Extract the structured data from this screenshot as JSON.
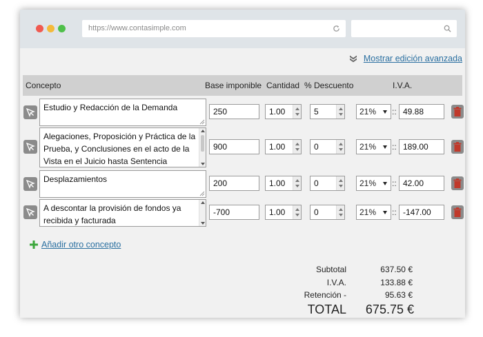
{
  "browser": {
    "url": "https://www.contasimple.com",
    "controls": [
      "close-dot",
      "minimize-dot",
      "maximize-dot"
    ],
    "colors": {
      "close": "#f05a50",
      "minimize": "#f4ba3a",
      "maximize": "#4fc04a"
    }
  },
  "toolbar": {
    "advanced_link": "Mostrar edición avanzada",
    "advanced_icon": "double-chevron-down-icon"
  },
  "table": {
    "headers": {
      "concept": "Concepto",
      "base": "Base imponible",
      "qty": "Cantidad",
      "discount": "% Descuento",
      "vat": "I.V.A."
    },
    "rows": [
      {
        "concept": "Estudio y Redacción de la Demanda",
        "base": "250",
        "qty": "1.00",
        "discount": "5",
        "vat_rate": "21%",
        "vat_sep": "::",
        "vat_amount": "49.88"
      },
      {
        "concept": "Alegaciones, Proposición y Práctica de la Prueba, y Conclusiones en el acto de la Vista en el Juicio hasta Sentencia Definitiva",
        "base": "900",
        "qty": "1.00",
        "discount": "0",
        "vat_rate": "21%",
        "vat_sep": "::",
        "vat_amount": "189.00"
      },
      {
        "concept": "Desplazamientos",
        "base": "200",
        "qty": "1.00",
        "discount": "0",
        "vat_rate": "21%",
        "vat_sep": "::",
        "vat_amount": "42.00"
      },
      {
        "concept": "A descontar la provisión de fondos ya recibida y facturada",
        "base": "-700",
        "qty": "1.00",
        "discount": "0",
        "vat_rate": "21%",
        "vat_sep": "::",
        "vat_amount": "-147.00"
      }
    ],
    "row_icons": {
      "drag": "cursor-arrow-icon",
      "delete": "trash-icon"
    },
    "delete_color": "#c0392b"
  },
  "add_concept": {
    "label": "Añadir otro concepto",
    "icon": "plus-icon",
    "icon_color": "#3aa63a"
  },
  "totals": {
    "subtotal_label": "Subtotal",
    "subtotal_value": "637.50 €",
    "vat_label": "I.V.A.",
    "vat_value": "133.88 €",
    "retention_label": "Retención -",
    "retention_value": "95.63 €",
    "total_label": "TOTAL",
    "total_value": "675.75 €"
  }
}
